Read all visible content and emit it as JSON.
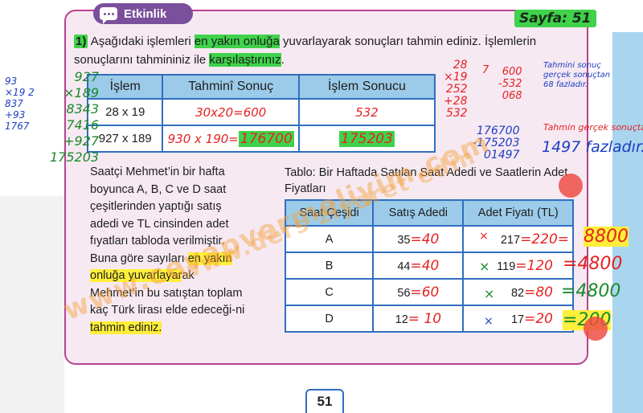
{
  "badge": {
    "label": "Etkinlik",
    "icon": "speech-bubble-icon"
  },
  "page_ref": "Sayfa: 51",
  "question": {
    "number": "1)",
    "text_1": "Aşağıdaki işlemleri ",
    "hl_1": "en yakın onluğa",
    "text_2": " yuvarlayarak sonuçları tahmin ediniz. İşlemlerin sonuçlarını tahmininiz ile ",
    "hl_2": "karşılaştırınız",
    "text_3": "."
  },
  "table1": {
    "headers": [
      "İşlem",
      "Tahminî Sonuç",
      "İşlem Sonucu"
    ],
    "rows": [
      {
        "op": "28 x 19",
        "estimate": "30x20=600",
        "result": "532"
      },
      {
        "op": "927 x 189",
        "estimate_a": "930 x 190=",
        "estimate_b": "176700",
        "result": "175203"
      }
    ]
  },
  "paragraph": {
    "text_1": "Saatçi Mehmet’in bir hafta boyunca A, B, C ve D saat çeşitlerinden yaptığı satış adedi ve TL cinsinden adet fıyatları tabloda verilmiştir. Buna göre sayıları ",
    "hl_1": "en yakın onluğa yuvarlayar",
    "text_2": "ak Mehmet’in bu satıştan toplam kaç Türk lirası elde edeceği-ni ",
    "hl_2": "tahmin ediniz."
  },
  "table2": {
    "title": "Tablo: Bir Haftada Satılan Saat Adedi ve Saatlerin Adet Fiyatları",
    "headers": [
      "Saat Çeşidi",
      "Satış Adedi",
      "Adet Fiyatı (TL)"
    ],
    "rows": [
      {
        "type": "A",
        "qty": "35",
        "qty_r": "=40",
        "price": "217",
        "price_r": "=220=",
        "total": "8800"
      },
      {
        "type": "B",
        "qty": "44",
        "qty_r": "=40",
        "price": "119",
        "price_r": "=120",
        "total": "=4800"
      },
      {
        "type": "C",
        "qty": "56",
        "qty_r": "=60",
        "price": "82",
        "price_r": "=80",
        "total": "=4800"
      },
      {
        "type": "D",
        "qty": "12",
        "qty_r": "= 10",
        "price": "17",
        "price_r": "=20",
        "total": "=200"
      }
    ]
  },
  "handwriting": {
    "left_mult_a": "93\n×19 2\n837\n+93\n1767",
    "left_mult_b": "927\n×189\n8343\n7416\n+927\n175203",
    "right_mult": "28\n×19\n252\n+28\n532",
    "right_sub": "600\n-532\n068",
    "right_sub2": "176700\n-175203\n01497",
    "note_1": "Tahmini sonuç gerçek sonuçtan 68 fazladır.",
    "note_2": "Tahmin gerçek sonuçtan",
    "note_3": "1497 fazladır.",
    "seven": "7"
  },
  "page_number": "51",
  "watermark_1": "www.cevapvermeliyim.com",
  "watermark_2": "www.ders ziyaret edin"
}
